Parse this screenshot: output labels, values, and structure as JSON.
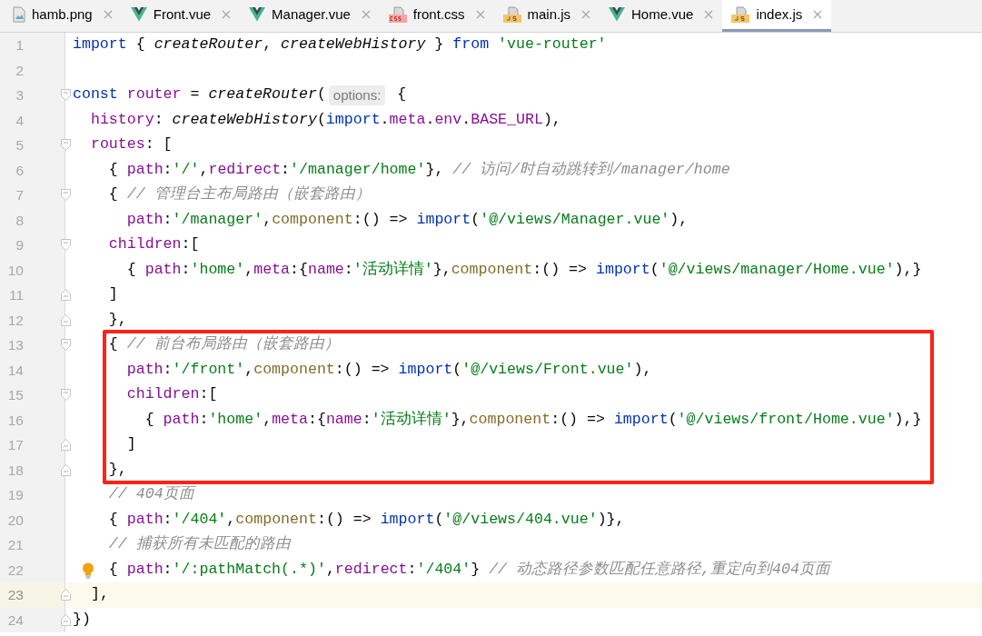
{
  "tabs": [
    {
      "label": "hamb.png",
      "kind": "image",
      "selected": false
    },
    {
      "label": "Front.vue",
      "kind": "vue",
      "selected": false
    },
    {
      "label": "Manager.vue",
      "kind": "vue",
      "selected": false
    },
    {
      "label": "front.css",
      "kind": "css",
      "selected": false
    },
    {
      "label": "main.js",
      "kind": "js",
      "selected": false
    },
    {
      "label": "Home.vue",
      "kind": "vue",
      "selected": false
    },
    {
      "label": "index.js",
      "kind": "js",
      "selected": true
    }
  ],
  "lines": [
    {
      "number": "1",
      "tokens": [
        {
          "text": "import ",
          "kind": "kw"
        },
        {
          "text": "{ ",
          "kind": "p"
        },
        {
          "text": "createRouter",
          "kind": "fn"
        },
        {
          "text": ", ",
          "kind": "p"
        },
        {
          "text": "createWebHistory",
          "kind": "fn"
        },
        {
          "text": " } ",
          "kind": "p"
        },
        {
          "text": "from ",
          "kind": "kw"
        },
        {
          "text": "'vue-router'",
          "kind": "str"
        }
      ]
    },
    {
      "number": "2"
    },
    {
      "number": "3",
      "fold_start": true,
      "tokens": [
        {
          "text": "const ",
          "kind": "kw"
        },
        {
          "text": "router",
          "kind": "prop"
        },
        {
          "text": " = ",
          "kind": "p"
        },
        {
          "text": "createRouter",
          "kind": "fn"
        },
        {
          "text": "(",
          "kind": "p"
        },
        {
          "text": "options:",
          "kind": "hint"
        },
        {
          "text": " {",
          "kind": "p"
        }
      ]
    },
    {
      "number": "4",
      "tokens": [
        {
          "text": "  history",
          "kind": "prop"
        },
        {
          "text": ": ",
          "kind": "p"
        },
        {
          "text": "createWebHistory",
          "kind": "fn"
        },
        {
          "text": "(",
          "kind": "p"
        },
        {
          "text": "import",
          "kind": "kw"
        },
        {
          "text": ".",
          "kind": "p"
        },
        {
          "text": "meta",
          "kind": "prop"
        },
        {
          "text": ".",
          "kind": "p"
        },
        {
          "text": "env",
          "kind": "prop"
        },
        {
          "text": ".",
          "kind": "p"
        },
        {
          "text": "BASE_URL",
          "kind": "prop"
        },
        {
          "text": "),",
          "kind": "p"
        }
      ]
    },
    {
      "number": "5",
      "fold_start": true,
      "tokens": [
        {
          "text": "  routes",
          "kind": "prop"
        },
        {
          "text": ": [",
          "kind": "p"
        }
      ]
    },
    {
      "number": "6",
      "tokens": [
        {
          "text": "    { ",
          "kind": "p"
        },
        {
          "text": "path",
          "kind": "prop"
        },
        {
          "text": ":",
          "kind": "p"
        },
        {
          "text": "'/'",
          "kind": "str"
        },
        {
          "text": ",",
          "kind": "p"
        },
        {
          "text": "redirect",
          "kind": "prop"
        },
        {
          "text": ":",
          "kind": "p"
        },
        {
          "text": "'/manager/home'",
          "kind": "str"
        },
        {
          "text": "}, ",
          "kind": "p"
        },
        {
          "text": "// 访问/时自动跳转到/manager/home",
          "kind": "cm"
        }
      ]
    },
    {
      "number": "7",
      "fold_start": true,
      "tokens": [
        {
          "text": "    { ",
          "kind": "p"
        },
        {
          "text": "// 管理台主布局路由（嵌套路由）",
          "kind": "cm"
        }
      ]
    },
    {
      "number": "8",
      "tokens": [
        {
          "text": "      path",
          "kind": "prop"
        },
        {
          "text": ":",
          "kind": "p"
        },
        {
          "text": "'/manager'",
          "kind": "str"
        },
        {
          "text": ",",
          "kind": "p"
        },
        {
          "text": "component",
          "kind": "mth"
        },
        {
          "text": ":() => ",
          "kind": "p"
        },
        {
          "text": "import",
          "kind": "kw"
        },
        {
          "text": "(",
          "kind": "p"
        },
        {
          "text": "'@/views/Manager.vue'",
          "kind": "str"
        },
        {
          "text": "),",
          "kind": "p"
        }
      ]
    },
    {
      "number": "9",
      "fold_start": true,
      "tokens": [
        {
          "text": "    children",
          "kind": "prop"
        },
        {
          "text": ":[",
          "kind": "p"
        }
      ]
    },
    {
      "number": "10",
      "tokens": [
        {
          "text": "      { ",
          "kind": "p"
        },
        {
          "text": "path",
          "kind": "prop"
        },
        {
          "text": ":",
          "kind": "p"
        },
        {
          "text": "'home'",
          "kind": "str"
        },
        {
          "text": ",",
          "kind": "p"
        },
        {
          "text": "meta",
          "kind": "prop"
        },
        {
          "text": ":{",
          "kind": "p"
        },
        {
          "text": "name",
          "kind": "prop"
        },
        {
          "text": ":",
          "kind": "p"
        },
        {
          "text": "'活动详情'",
          "kind": "str"
        },
        {
          "text": "},",
          "kind": "p"
        },
        {
          "text": "component",
          "kind": "mth"
        },
        {
          "text": ":() => ",
          "kind": "p"
        },
        {
          "text": "import",
          "kind": "kw"
        },
        {
          "text": "(",
          "kind": "p"
        },
        {
          "text": "'@/views/manager/Home.vue'",
          "kind": "str"
        },
        {
          "text": "),}",
          "kind": "p"
        }
      ]
    },
    {
      "number": "11",
      "fold_end": true,
      "tokens": [
        {
          "text": "    ]",
          "kind": "p"
        }
      ]
    },
    {
      "number": "12",
      "fold_end": true,
      "tokens": [
        {
          "text": "    },",
          "kind": "p"
        }
      ]
    },
    {
      "number": "13",
      "fold_start": true,
      "boxed": true,
      "tokens": [
        {
          "text": "    { ",
          "kind": "p"
        },
        {
          "text": "// 前台布局路由（嵌套路由）",
          "kind": "cm"
        }
      ]
    },
    {
      "number": "14",
      "boxed": true,
      "tokens": [
        {
          "text": "      path",
          "kind": "prop"
        },
        {
          "text": ":",
          "kind": "p"
        },
        {
          "text": "'/front'",
          "kind": "str"
        },
        {
          "text": ",",
          "kind": "p"
        },
        {
          "text": "component",
          "kind": "mth"
        },
        {
          "text": ":() => ",
          "kind": "p"
        },
        {
          "text": "import",
          "kind": "kw"
        },
        {
          "text": "(",
          "kind": "p"
        },
        {
          "text": "'@/views/Front.vue'",
          "kind": "str"
        },
        {
          "text": "),",
          "kind": "p"
        }
      ]
    },
    {
      "number": "15",
      "fold_start": true,
      "boxed": true,
      "tokens": [
        {
          "text": "      children",
          "kind": "prop"
        },
        {
          "text": ":[",
          "kind": "p"
        }
      ]
    },
    {
      "number": "16",
      "boxed": true,
      "tokens": [
        {
          "text": "        { ",
          "kind": "p"
        },
        {
          "text": "path",
          "kind": "prop"
        },
        {
          "text": ":",
          "kind": "p"
        },
        {
          "text": "'home'",
          "kind": "str"
        },
        {
          "text": ",",
          "kind": "p"
        },
        {
          "text": "meta",
          "kind": "prop"
        },
        {
          "text": ":{",
          "kind": "p"
        },
        {
          "text": "name",
          "kind": "prop"
        },
        {
          "text": ":",
          "kind": "p"
        },
        {
          "text": "'活动详情'",
          "kind": "str"
        },
        {
          "text": "},",
          "kind": "p"
        },
        {
          "text": "component",
          "kind": "mth"
        },
        {
          "text": ":() => ",
          "kind": "p"
        },
        {
          "text": "import",
          "kind": "kw"
        },
        {
          "text": "(",
          "kind": "p"
        },
        {
          "text": "'@/views/front/Home.vue'",
          "kind": "str"
        },
        {
          "text": "),}",
          "kind": "p"
        }
      ]
    },
    {
      "number": "17",
      "fold_end": true,
      "boxed": true,
      "tokens": [
        {
          "text": "      ]",
          "kind": "p"
        }
      ]
    },
    {
      "number": "18",
      "fold_end": true,
      "boxed": true,
      "tokens": [
        {
          "text": "    },",
          "kind": "p"
        }
      ]
    },
    {
      "number": "19",
      "tokens": [
        {
          "text": "    // 404页面",
          "kind": "cm"
        }
      ]
    },
    {
      "number": "20",
      "tokens": [
        {
          "text": "    { ",
          "kind": "p"
        },
        {
          "text": "path",
          "kind": "prop"
        },
        {
          "text": ":",
          "kind": "p"
        },
        {
          "text": "'/404'",
          "kind": "str"
        },
        {
          "text": ",",
          "kind": "p"
        },
        {
          "text": "component",
          "kind": "mth"
        },
        {
          "text": ":() => ",
          "kind": "p"
        },
        {
          "text": "import",
          "kind": "kw"
        },
        {
          "text": "(",
          "kind": "p"
        },
        {
          "text": "'@/views/404.vue'",
          "kind": "str"
        },
        {
          "text": ")},",
          "kind": "p"
        }
      ]
    },
    {
      "number": "21",
      "tokens": [
        {
          "text": "    // 捕获所有未匹配的路由",
          "kind": "cm"
        }
      ]
    },
    {
      "number": "22",
      "bulb": true,
      "tokens": [
        {
          "text": "    { ",
          "kind": "p"
        },
        {
          "text": "path",
          "kind": "prop"
        },
        {
          "text": ":",
          "kind": "p"
        },
        {
          "text": "'/:pathMatch(.*)'",
          "kind": "str"
        },
        {
          "text": ",",
          "kind": "p"
        },
        {
          "text": "redirect",
          "kind": "prop"
        },
        {
          "text": ":",
          "kind": "p"
        },
        {
          "text": "'/404'",
          "kind": "str"
        },
        {
          "text": "} ",
          "kind": "p"
        },
        {
          "text": "// 动态路径参数匹配任意路径,重定向到404页面",
          "kind": "cm"
        }
      ]
    },
    {
      "number": "23",
      "current": true,
      "fold_end": true,
      "tokens": [
        {
          "text": "  ],",
          "kind": "p"
        }
      ]
    },
    {
      "number": "24",
      "fold_end": true,
      "tokens": [
        {
          "text": "})",
          "kind": "p"
        }
      ]
    }
  ]
}
